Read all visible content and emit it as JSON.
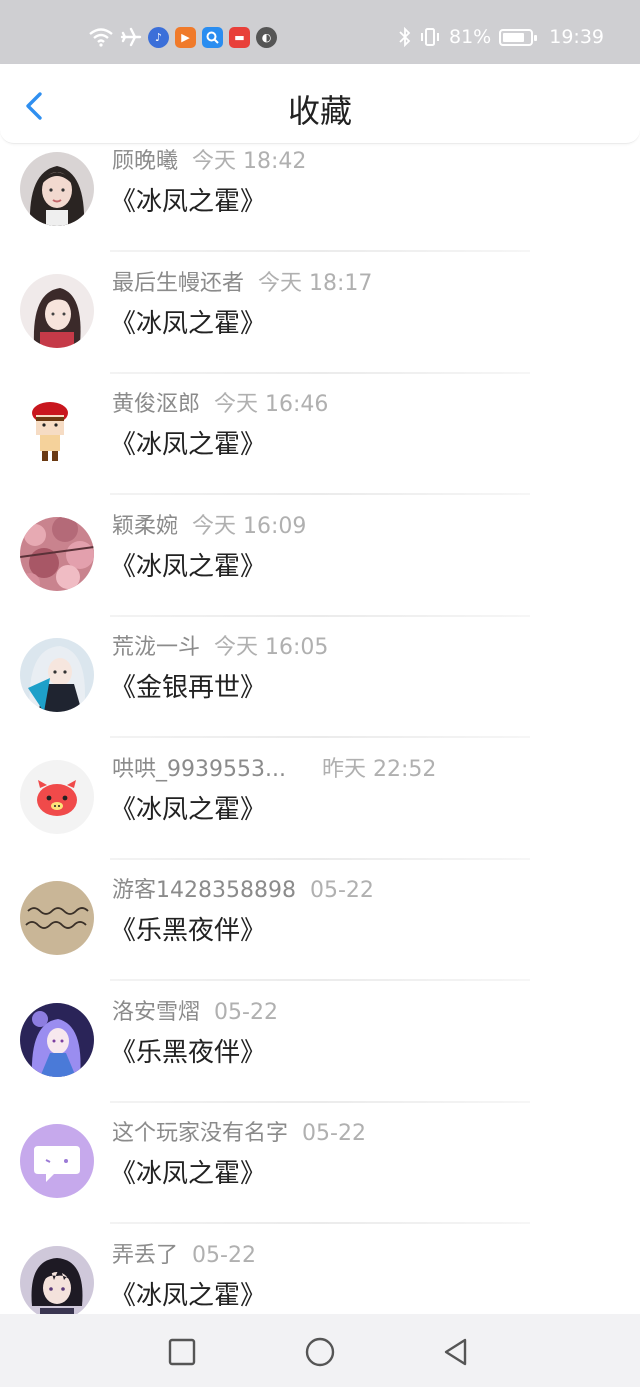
{
  "status_bar": {
    "icons_left": [
      "wifi-icon",
      "airplane-icon",
      "music-app-icon",
      "video-app-icon",
      "search-app-icon",
      "store-app-icon",
      "ball-app-icon"
    ],
    "app_colors": {
      "music": "#3b6fd9",
      "video": "#f07a2a",
      "search": "#2a8df0",
      "store": "#e8403a",
      "ball": "#555555"
    },
    "bluetooth": "bluetooth-icon",
    "vibrate": "vibrate-icon",
    "battery_percent": "81%",
    "battery_level": 0.81,
    "time": "19:39"
  },
  "header": {
    "title": "收藏",
    "back_icon": "chevron-left-icon",
    "accent": "#2f8ff0"
  },
  "favorites": [
    {
      "name": "顾晚曦",
      "time": "今天 18:42",
      "game": "《冰凤之霍》",
      "avatar": "avatar-photo-girl"
    },
    {
      "name": "最后生幔还者",
      "time": "今天 18:17",
      "game": "《冰凤之霍》",
      "avatar": "avatar-anime-girl"
    },
    {
      "name": "黄俊沤郎",
      "time": "今天 16:46",
      "game": "《冰凤之霍》",
      "avatar": "avatar-red-hat-boy"
    },
    {
      "name": "颖柔婉",
      "time": "今天 16:09",
      "game": "《冰凤之霍》",
      "avatar": "avatar-pink-blossom"
    },
    {
      "name": "荒泷一斗",
      "time": "今天 16:05",
      "game": "《金银再世》",
      "avatar": "avatar-anime-character"
    },
    {
      "name": "哄哄_9939553...",
      "time": "昨天 22:52",
      "game": "《冰凤之霍》",
      "avatar": "avatar-red-pig"
    },
    {
      "name": "游客1428358898",
      "time": "05-22",
      "game": "《乐黑夜伴》",
      "avatar": "avatar-handwriting"
    },
    {
      "name": "洛安雪熠",
      "time": "05-22",
      "game": "《乐黑夜伴》",
      "avatar": "avatar-purple-anime"
    },
    {
      "name": "这个玩家没有名字",
      "time": "05-22",
      "game": "《冰凤之霍》",
      "avatar": "avatar-default-chat"
    },
    {
      "name": "弄丢了",
      "time": "05-22",
      "game": "《冰凤之霍》",
      "avatar": "avatar-dark-hair-boy"
    }
  ],
  "system_nav": {
    "recent": "square-icon",
    "home": "circle-icon",
    "back": "triangle-back-icon"
  }
}
